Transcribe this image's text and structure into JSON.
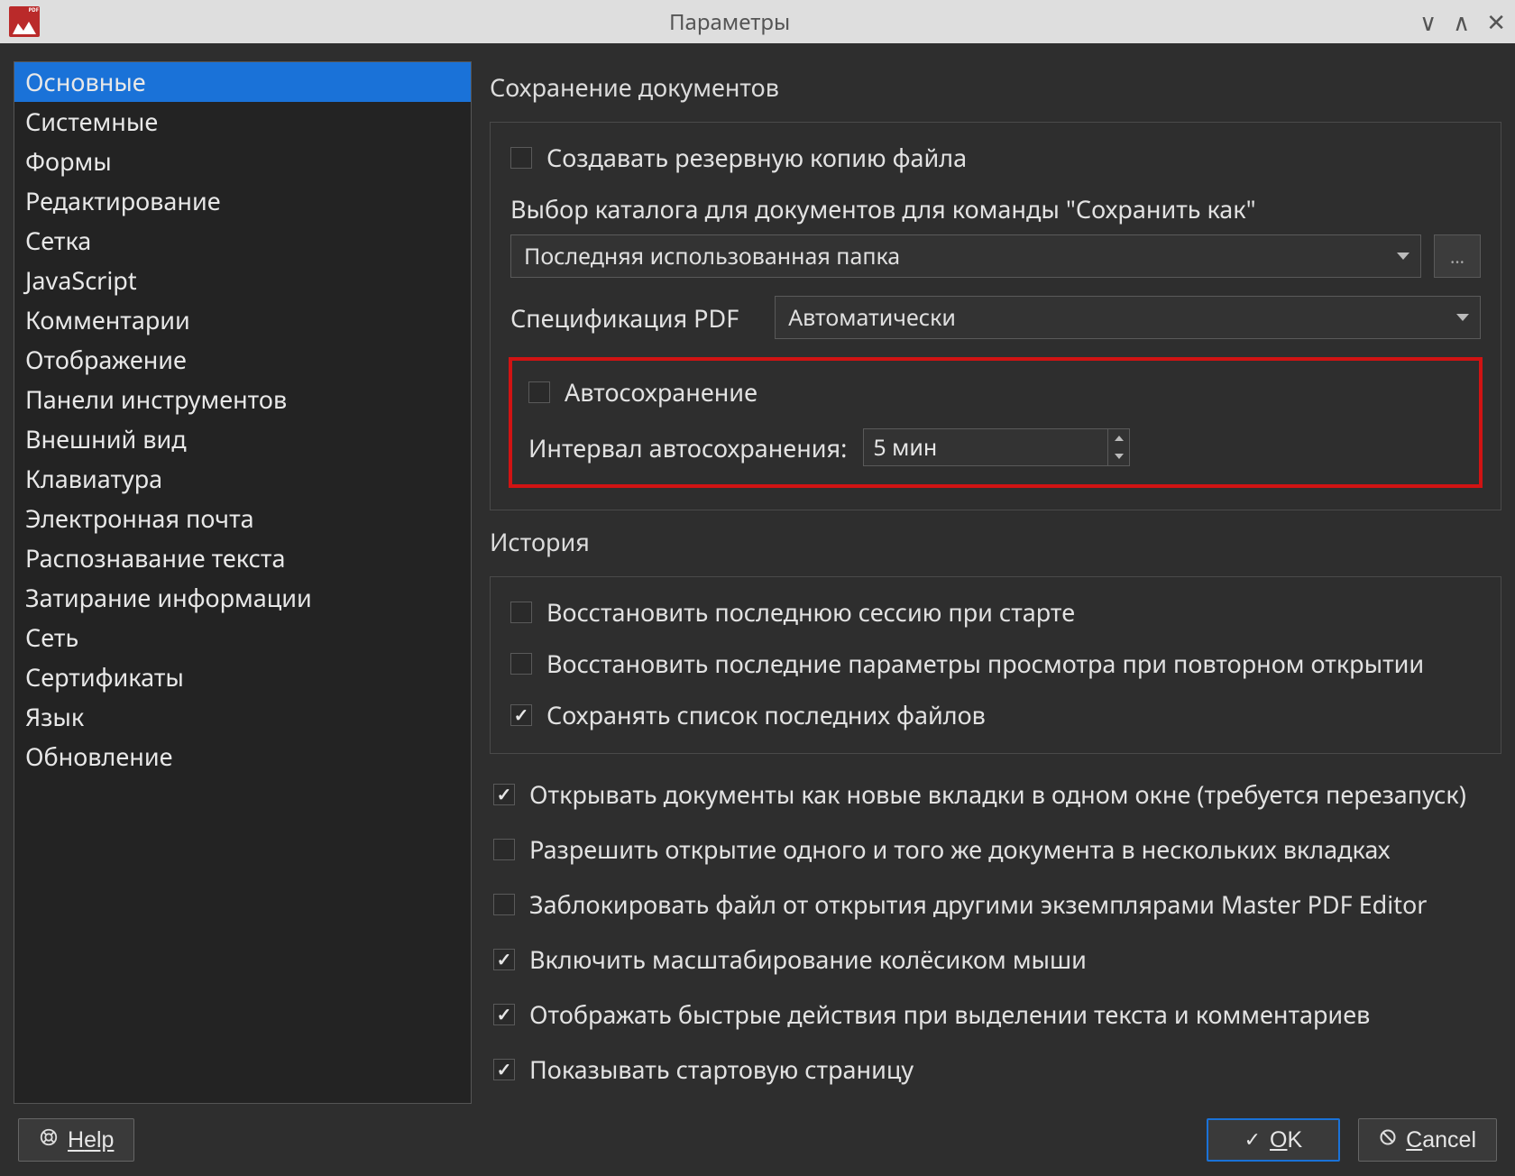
{
  "window": {
    "title": "Параметры"
  },
  "sidebar": {
    "items": [
      "Основные",
      "Системные",
      "Формы",
      "Редактирование",
      "Сетка",
      "JavaScript",
      "Комментарии",
      "Отображение",
      "Панели инструментов",
      "Внешний вид",
      "Клавиатура",
      "Электронная почта",
      "Распознавание текста",
      "Затирание информации",
      "Сеть",
      "Сертификаты",
      "Язык",
      "Обновление"
    ],
    "selected_index": 0
  },
  "sections": {
    "save": {
      "title": "Сохранение документов",
      "backup_copy": "Создавать резервную копию файла",
      "saveas_label": "Выбор каталога для документов для команды \"Сохранить как\"",
      "saveas_value": "Последняя использованная папка",
      "browse": "...",
      "spec_label": "Спецификация PDF",
      "spec_value": "Автоматически",
      "autosave": "Автосохранение",
      "interval_label": "Интервал автосохранения:",
      "interval_value": "5 мин"
    },
    "history": {
      "title": "История",
      "restore_session": "Восстановить последнюю сессию при старте",
      "restore_view": "Восстановить последние параметры просмотра при повторном открытии",
      "save_recent": "Сохранять список последних файлов"
    },
    "misc": {
      "open_as_tabs": "Открывать документы как новые вкладки в одном окне (требуется перезапуск)",
      "allow_same_doc": "Разрешить открытие одного и того же документа в нескольких вкладках",
      "lock_file": "Заблокировать файл от открытия другими экземплярами Master PDF Editor",
      "wheel_zoom": "Включить масштабирование колёсиком мыши",
      "quick_actions": "Отображать быстрые действия при выделении текста и комментариев",
      "show_start": "Показывать стартовую страницу"
    }
  },
  "buttons": {
    "help": "Help",
    "ok": "OK",
    "cancel": "Cancel"
  }
}
